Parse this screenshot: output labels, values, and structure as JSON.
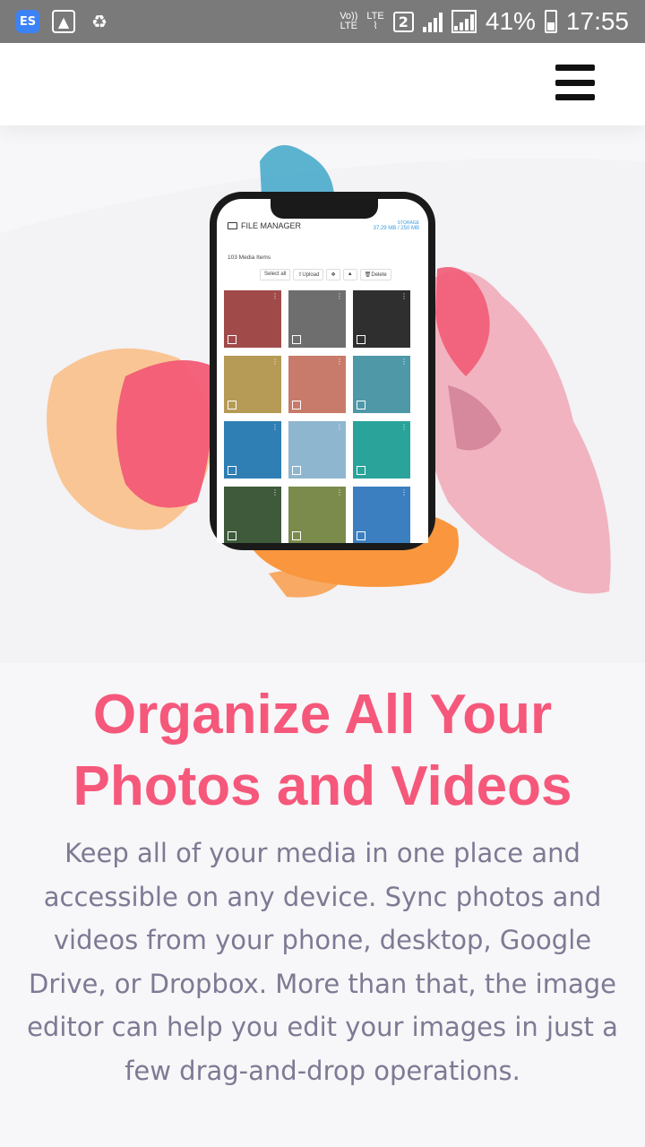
{
  "status_bar": {
    "volte_top": "Vo))",
    "volte_bottom": "LTE",
    "lte_label": "LTE",
    "sim_number": "2",
    "battery_percent": "41%",
    "time": "17:55"
  },
  "header": {
    "menu_icon": "hamburger-menu-icon"
  },
  "phone_screen": {
    "title": "FILE MANAGER",
    "storage_label": "STORAGE",
    "storage_value": "37.29 MB / 250 MB",
    "media_count": "103 Media Items",
    "toolbar": {
      "select_all": "Select all",
      "upload": "Upload",
      "delete": "Delete"
    },
    "thumb_colors": [
      "#a14a4a",
      "#6e6e6e",
      "#2f2f2f",
      "#b59b55",
      "#c87b6a",
      "#4f98a8",
      "#2f7fb5",
      "#8fb6cf",
      "#2aa39a",
      "#3e5a3a",
      "#7a8b4c",
      "#3b7fc0"
    ]
  },
  "content": {
    "headline_line1": "Organize All Your",
    "headline_line2": "Photos and Videos",
    "body": "Keep all of your media in one place and accessible on any device. Sync photos and videos from your phone, desktop, Google Drive, or Dropbox. More than that, the image editor can help you edit your images in just a few drag-and-drop operations."
  },
  "colors": {
    "headline": "#f5587b",
    "body_text": "#7d7a94",
    "splash_pink": "#f0a8b6",
    "splash_red": "#f25b75",
    "splash_orange": "#f9963e",
    "splash_peach": "#f9c08a",
    "splash_blue": "#3fa7c9"
  }
}
